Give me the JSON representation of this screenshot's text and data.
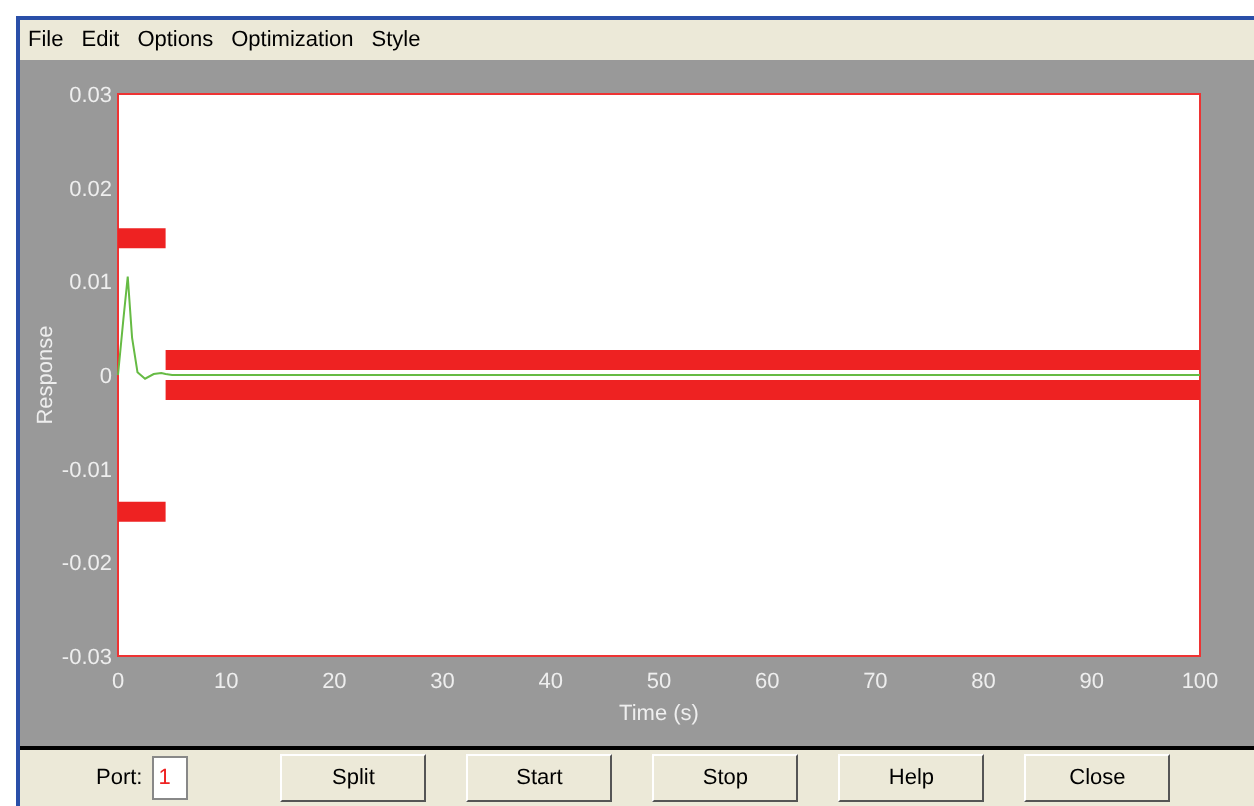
{
  "menu": [
    "File",
    "Edit",
    "Options",
    "Optimization",
    "Style"
  ],
  "plot": {
    "chart_data": {
      "type": "line",
      "xlabel": "Time (s)",
      "ylabel": "Response",
      "xlim": [
        0,
        100
      ],
      "ylim": [
        -0.03,
        0.03
      ],
      "xticks": [
        0,
        10,
        20,
        30,
        40,
        50,
        60,
        70,
        80,
        90,
        100
      ],
      "yticks": [
        {
          "value": 0.03,
          "label": "0.03"
        },
        {
          "value": 0.02,
          "label": "0.02"
        },
        {
          "value": 0.01,
          "label": "0.01"
        },
        {
          "value": 0,
          "label": "0"
        },
        {
          "value": -0.01,
          "label": "-0.01"
        },
        {
          "value": -0.02,
          "label": "-0.02"
        },
        {
          "value": -0.03,
          "label": "-0.03"
        }
      ],
      "x": [
        0,
        0.5,
        0.9,
        1.3,
        1.8,
        2.5,
        3.3,
        4,
        4.4,
        4.4,
        5,
        10,
        20,
        30,
        40,
        50,
        60,
        70,
        80,
        90,
        100
      ],
      "series": [
        {
          "color": "#66bb44",
          "values": [
            0,
            0.006,
            0.0105,
            0.004,
            0.0003,
            -0.0004,
            0.0001,
            0.0002,
            0.0001,
            0.0001,
            0,
            0,
            0,
            0,
            0,
            0,
            0,
            0,
            0,
            0,
            0
          ]
        },
        {
          "color": "#ee2222",
          "values": [
            0.0146,
            0.0146,
            0.0146,
            0.0146,
            0.0146,
            0.0146,
            0.0146,
            0.0146,
            0.0146,
            null,
            null,
            null,
            null,
            null,
            null,
            null,
            null,
            null,
            null,
            null,
            null
          ]
        },
        {
          "color": "#ee2222",
          "values": [
            -0.0146,
            -0.0146,
            -0.0146,
            -0.0146,
            -0.0146,
            -0.0146,
            -0.0146,
            -0.0146,
            -0.0146,
            null,
            null,
            null,
            null,
            null,
            null,
            null,
            null,
            null,
            null,
            null,
            null
          ]
        },
        {
          "color": "#ee2222",
          "values": [
            null,
            null,
            null,
            null,
            null,
            null,
            null,
            null,
            null,
            0.0016,
            0.0016,
            0.0016,
            0.0016,
            0.0016,
            0.0016,
            0.0016,
            0.0016,
            0.0016,
            0.0016,
            0.0016,
            0.0016
          ]
        },
        {
          "color": "#ee2222",
          "values": [
            null,
            null,
            null,
            null,
            null,
            null,
            null,
            null,
            null,
            -0.0016,
            -0.0016,
            -0.0016,
            -0.0016,
            -0.0016,
            -0.0016,
            -0.0016,
            -0.0016,
            -0.0016,
            -0.0016,
            -0.0016,
            -0.0016
          ]
        }
      ]
    }
  },
  "port": {
    "label": "Port:",
    "value": "1"
  },
  "buttons": [
    "Split",
    "Start",
    "Stop",
    "Help",
    "Close"
  ]
}
